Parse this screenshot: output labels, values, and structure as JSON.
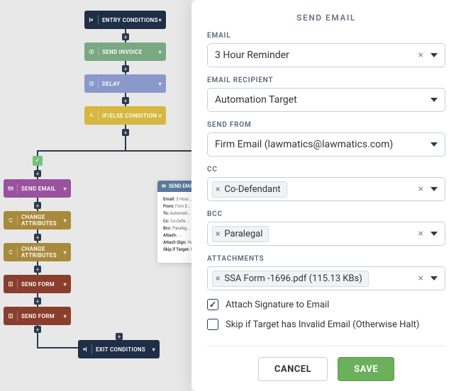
{
  "workflow": {
    "nodes": {
      "entry": "ENTRY CONDITIONS",
      "send_invoice": "SEND INVOICE",
      "delay": "DELAY",
      "if_else": "IF/ELSE CONDITION",
      "send_email": "SEND EMAIL",
      "change_attr_1": "CHANGE ATTRIBUTES",
      "change_attr_2": "CHANGE ATTRIBUTES",
      "send_form_1": "SEND FORM",
      "send_form_2": "SEND FORM",
      "exit": "EXIT CONDITIONS"
    }
  },
  "preview": {
    "header": "SEND EMAIL",
    "rows": [
      {
        "k": "Email:",
        "v": "3 Hour..."
      },
      {
        "k": "From:",
        "v": "Firm E..."
      },
      {
        "k": "To:",
        "v": "Automati..."
      },
      {
        "k": "Cc:",
        "v": "Co-Defe..."
      },
      {
        "k": "Bcc:",
        "v": "Paraleg..."
      },
      {
        "k": "Attach:",
        "v": "..."
      },
      {
        "k": "Attach Sign:",
        "v": "Yes"
      },
      {
        "k": "Skip if Target:",
        "v": "No"
      }
    ]
  },
  "panel": {
    "title": "SEND EMAIL",
    "labels": {
      "email": "EMAIL",
      "recipient": "EMAIL RECIPIENT",
      "send_from": "SEND FROM",
      "cc": "CC",
      "bcc": "BCC",
      "attachments": "ATTACHMENTS"
    },
    "values": {
      "email": "3 Hour Reminder",
      "recipient": "Automation Target",
      "send_from": "Firm Email (lawmatics@lawmatics.com)",
      "cc": "Co-Defendant",
      "bcc": "Paralegal",
      "attachment": "SSA Form -1696.pdf (115.13 KBs)"
    },
    "checks": {
      "attach_sig": "Attach Signature to Email",
      "skip_target": "Skip if Target has Invalid Email (Otherwise Halt)"
    },
    "buttons": {
      "cancel": "CANCEL",
      "save": "SAVE"
    }
  }
}
